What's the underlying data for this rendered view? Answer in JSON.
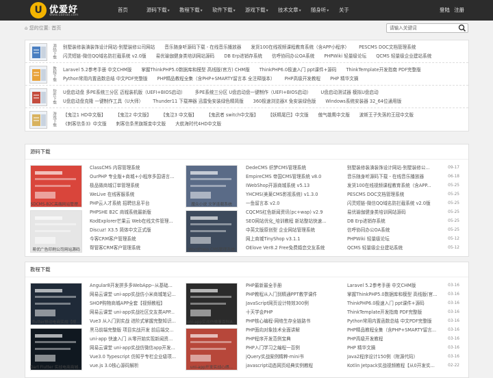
{
  "site": {
    "name": "优爱好",
    "url": "www.uaihao.com",
    "logo_glyph": "U"
  },
  "nav": [
    {
      "label": "首页",
      "arrow": false
    },
    {
      "label": "源码下载",
      "arrow": true
    },
    {
      "label": "教程下载",
      "arrow": true
    },
    {
      "label": "软件下载",
      "arrow": true
    },
    {
      "label": "游戏下载",
      "arrow": true
    },
    {
      "label": "技术文章",
      "arrow": true
    },
    {
      "label": "随身听",
      "arrow": true
    },
    {
      "label": "关于",
      "arrow": false
    }
  ],
  "auth": {
    "login": "登陆",
    "register": "注册"
  },
  "breadcrumb": {
    "prefix": "您的位置:",
    "home": "首页"
  },
  "search": {
    "placeholder": "请输入关键词"
  },
  "categories": [
    {
      "name": "源码下载",
      "rows": [
        [
          "别墅装修装潢装饰设计网站-别墅装修公司网站",
          "音乐随身听源码下载 - 在线音乐播放器",
          "发货100在线视频课程教育系统（含APP小程序）",
          "PESCMS DOC文档管理系统"
        ],
        [
          "闪灵短链-微信QQ域名防拦截系统 v2.0版",
          "易优瑜伽健身类培训网站源码",
          "DB Erp进销存系统",
          "信呼协同办公OA系统",
          "PHPWiki 轻量级论坛",
          "QCMS 轻量级企业建站系统"
        ]
      ]
    },
    {
      "name": "教程下载",
      "rows": [
        [
          "Laravel 5.2参考手册 中文CHM版",
          "掌握ThinkPHP5.0数据库和模型 高线版(官方) CHM版",
          "ThinkPHP6.0极速入门 ppt课件+源码",
          "ThinkTemplate开发指南 PDF完整版"
        ],
        [
          "Python常用内置函数总结 中文PDF完整版",
          "PHP精品教程全集（含PHP+SMARTY留言本 全注释版本）",
          "PHP高级开发教程",
          "PHP 精华文摘"
        ]
      ]
    },
    {
      "name": "软件下载",
      "rows": [
        [
          "U盘启动盘 多PE系统三分区 迈程装机版（UEFI+BIOS启动）",
          "多PE系统三分区 U盘启动盘一键制作（UEFI+BIOS启动）",
          "U盘启动测试器 模拟U盘启动"
        ],
        [
          "U盘启动盘克隆 一键制作工具（U大师）",
          "Thunder11 下载神器 迅雷免安装绿色精简版",
          "360极速浏览器X 免安装绿色版",
          "Windows系统安装器 32_64位通用版"
        ]
      ]
    },
    {
      "name": "游戏下载",
      "rows": [
        [
          "【鬼泣1 HD中文版】",
          "【鬼泣2 中文版】",
          "【鬼泣3 中文版】",
          "【鬼武者 switch中文版】",
          "【妖精尾巴】中文版",
          "傲气雄鹰中文版",
          "波斯王子失落的王冠中文版"
        ],
        [
          "《刺客信条3》中文版",
          "刺客信条黑旗叛变中文版",
          "大航海时代4HD中文版"
        ]
      ]
    }
  ],
  "section_source": {
    "title": "源码下载",
    "thumbs": [
      "SDCMS-B2C高端网站管理...",
      "魔众小说 文学连载系统",
      "易优广告印刷公司网站源码",
      "WordPress CMS管理系统"
    ],
    "col1": [
      "ClassCMS 内容管理系统",
      "OurPHP 专业版+商城+小程序多国语言...",
      "极品微商城订单管理系统",
      "WeLive 在线客服系统",
      "PHP云人才系统 招聘信息平台",
      "PHPSHE B2C 商城系统最新版",
      "KodExplorer芒果云 Web在线文件管理...",
      "Discuz! X3.5 简体中文正式版",
      "今客CRM客户管理系统",
      "帮管客CRM客户管理系统"
    ],
    "col2": [
      "DedeCMS 织梦CMS管理系统",
      "EmpireCMS 帝国CMS管理系统 v8.0",
      "IWebShop开源商城系统 v5.13",
      "YHCMS(美莱CMS影视系统) v1.3.0",
      "一鱼留言本 v2.0",
      "CQCMS红色新闻资讯(pc+wap) v2.9",
      "SEO网站优化_培训教程 新站整站快速...",
      "中英文版原创型 企业网站管理系统",
      "网上商城TinyShop v3.1.1",
      "OElove Ver8.2 Free免费婚恋交友系统"
    ],
    "col3": [
      {
        "t": "别墅装修装潢装饰设计网站-别墅装修公...",
        "d": "09-17"
      },
      {
        "t": "音乐随身听源码下载 - 在线音乐播放器",
        "d": "06-18"
      },
      {
        "t": "发货100在线视频课程教育系统（含APP...",
        "d": "05-25"
      },
      {
        "t": "PESCMS DOC文档管理系统",
        "d": "05-25"
      },
      {
        "t": "闪灵短链-微信QQ域名防拦截系统 v2.0版",
        "d": "05-25"
      },
      {
        "t": "易优瑜伽健身类培训网站源码",
        "d": "05-25"
      },
      {
        "t": "DB Erp进销存系统",
        "d": "05-25"
      },
      {
        "t": "信呼协同办公OA系统",
        "d": "05-25"
      },
      {
        "t": "PHPWiki 轻量级论坛",
        "d": "05-12"
      },
      {
        "t": "QCMS 轻量级企业建站系统",
        "d": "05-12"
      }
    ]
  },
  "section_tutorial": {
    "title": "教程下载",
    "thumbs": [
      "flutter移动电商实战【视...",
      "uni-app实战仿微事百科A...",
      "Dart Flutter 实战电商商城...",
      "uni-app开发实战心得..."
    ],
    "col1": [
      "Angular8开发拼多多WebApp--从基础...",
      "网易云课堂 uni-app实战仿小米商城笔记...",
      "SHOP购物商城APP全套【视频教程】",
      "网易云课堂 uni-app实战社区交友类APP...",
      "Vue3 从入门到实战 进阶式掌握完整知识...",
      "黑马前端完整版 项目实战开发 前后端交...",
      "uni-app 快速入门 从零开始实现新闻资...",
      "网易云课堂 uni-app实战仿微信app开发...",
      "Vue3.0 Typescript 仿知乎专栏企业级项...",
      "vue.js 3.0核心源码解析"
    ],
    "col2": [
      "PHP最新最全手册",
      "PHP教程从入门到精通PPT教学课件",
      "JavaScript网页设计特效300例",
      "十天学会PHP",
      "PHP核心编程-网络生存全链路书",
      "PHP面向对象技术全面讲解",
      "PHP程序开发范例宝典",
      "PHP入门学习之编程一百例",
      "jQuery实战案例精粹-mini书",
      "javascript动态网页经典实例教程"
    ],
    "col3": [
      {
        "t": "Laravel 5.2参考手册 中文CHM版",
        "d": "03-16"
      },
      {
        "t": "掌握ThinkPHP5.0数据库和模型 高线版(官...",
        "d": "03-16"
      },
      {
        "t": "ThinkPHP6.0极速入门 ppt课件+源码",
        "d": "03-16"
      },
      {
        "t": "ThinkTemplate开发指南 PDF完整版",
        "d": "03-16"
      },
      {
        "t": "Python常用内置函数总结 中文PDF完整版",
        "d": "03-16"
      },
      {
        "t": "PHP精品教程全集（含PHP+SMARTY留言...",
        "d": "03-16"
      },
      {
        "t": "PHP高级开发教程",
        "d": "03-16"
      },
      {
        "t": "PHP 精华文摘",
        "d": "03-16"
      },
      {
        "t": "Java2程序设计150例（附源代码）",
        "d": "03-16"
      },
      {
        "t": "Kotlin Jetpack实战视频教程【从0开发实...",
        "d": "02-22"
      }
    ]
  },
  "colors": {
    "topbar": "#2c2c2c",
    "accent": "#f4b400",
    "link": "#555555"
  }
}
